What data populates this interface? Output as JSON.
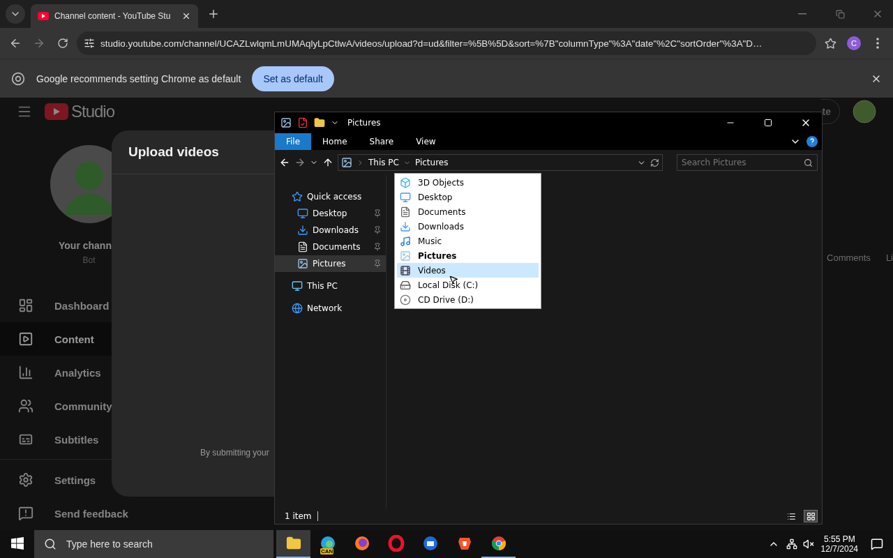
{
  "browser": {
    "tab": {
      "title": "Channel content - YouTube Stu"
    },
    "url": "studio.youtube.com/channel/UCAZLwlqmLmUMAqlyLpCtlwA/videos/upload?d=ud&filter=%5B%5D&sort=%7B\"columnType\"%3A\"date\"%2C\"sortOrder\"%3A\"D…",
    "profile": "C",
    "infobar": {
      "message": "Google recommends setting Chrome as default",
      "button": "Set as default"
    }
  },
  "studio": {
    "logo": "Studio",
    "create_button": "te",
    "channel": {
      "name": "Your chann",
      "handle": "Bot"
    },
    "nav": [
      {
        "kind": "dashboard",
        "label": "Dashboard",
        "selected": false
      },
      {
        "kind": "content",
        "label": "Content",
        "selected": true
      },
      {
        "kind": "analytics",
        "label": "Analytics",
        "selected": false
      },
      {
        "kind": "community",
        "label": "Community",
        "selected": false
      },
      {
        "kind": "subtitles",
        "label": "Subtitles",
        "selected": false
      }
    ],
    "nav_bottom": [
      {
        "kind": "settings",
        "label": "Settings"
      },
      {
        "kind": "feedback",
        "label": "Send feedback"
      }
    ],
    "table_columns": [
      "Comments",
      "Li"
    ],
    "dialog": {
      "title": "Upload videos",
      "footer": "By submitting your"
    }
  },
  "explorer": {
    "title": "Pictures",
    "ribbon_tabs": [
      {
        "label": "File",
        "selected": true
      },
      {
        "label": "Home",
        "selected": false
      },
      {
        "label": "Share",
        "selected": false
      },
      {
        "label": "View",
        "selected": false
      }
    ],
    "breadcrumb": [
      "This PC",
      "Pictures"
    ],
    "search": {
      "placeholder": "Search Pictures"
    },
    "nav": [
      {
        "kind": "star",
        "label": "Quick access",
        "pinned": false,
        "selected": false,
        "children": [
          {
            "kind": "desktop",
            "label": "Desktop",
            "pinned": true,
            "selected": false
          },
          {
            "kind": "downloads",
            "label": "Downloads",
            "pinned": true,
            "selected": false
          },
          {
            "kind": "documents",
            "label": "Documents",
            "pinned": true,
            "selected": false
          },
          {
            "kind": "pictures",
            "label": "Pictures",
            "pinned": true,
            "selected": true
          }
        ]
      },
      {
        "kind": "pc",
        "label": "This PC",
        "pinned": false,
        "selected": false
      },
      {
        "kind": "network",
        "label": "Network",
        "pinned": false,
        "selected": false
      }
    ],
    "dropdown": [
      {
        "kind": "objects3d",
        "label": "3D Objects",
        "current": false,
        "hovered": false
      },
      {
        "kind": "desktop",
        "label": "Desktop",
        "current": false,
        "hovered": false
      },
      {
        "kind": "documents",
        "label": "Documents",
        "current": false,
        "hovered": false
      },
      {
        "kind": "downloads",
        "label": "Downloads",
        "current": false,
        "hovered": false
      },
      {
        "kind": "music",
        "label": "Music",
        "current": false,
        "hovered": false
      },
      {
        "kind": "pictures",
        "label": "Pictures",
        "current": true,
        "hovered": false
      },
      {
        "kind": "videos",
        "label": "Videos",
        "current": false,
        "hovered": true
      },
      {
        "kind": "disk",
        "label": "Local Disk (C:)",
        "current": false,
        "hovered": false
      },
      {
        "kind": "cd",
        "label": "CD Drive (D:)",
        "current": false,
        "hovered": false
      }
    ],
    "status": "1 item",
    "views": [
      {
        "kind": "details",
        "selected": false
      },
      {
        "kind": "tiles",
        "selected": true
      }
    ]
  },
  "taskbar": {
    "search": {
      "placeholder": "Type here to search"
    },
    "apps": [
      {
        "kind": "explorer",
        "open": true,
        "focused": true
      },
      {
        "kind": "edge",
        "open": false,
        "focused": false,
        "badge": "CAN"
      },
      {
        "kind": "firefox",
        "open": false,
        "focused": false
      },
      {
        "kind": "opera",
        "open": false,
        "focused": false
      },
      {
        "kind": "thunderbird",
        "open": false,
        "focused": false
      },
      {
        "kind": "brave",
        "open": false,
        "focused": false
      },
      {
        "kind": "chrome",
        "open": true,
        "focused": false
      }
    ],
    "time": "5:55 PM",
    "date": "12/7/2024"
  }
}
